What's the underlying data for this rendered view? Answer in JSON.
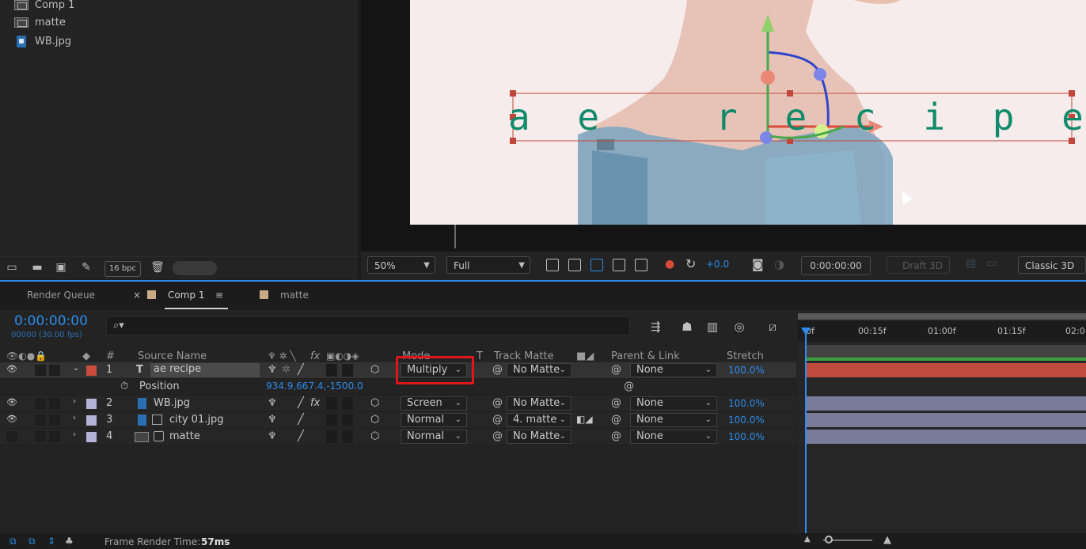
{
  "project": {
    "items": [
      {
        "name": "Comp 1",
        "icon": "comp-icon"
      },
      {
        "name": "matte",
        "icon": "comp-icon"
      },
      {
        "name": "WB.jpg",
        "icon": "image-file-icon"
      }
    ],
    "bpc": "16 bpc"
  },
  "viewer": {
    "overlay_text": "a e   r e c i p e",
    "zoom": "50%",
    "resolution": "Full",
    "exposure_offset": "+0.0",
    "timecode": "0:00:00:00",
    "draft3d": "Draft 3D",
    "renderer": "Classic 3D"
  },
  "timeline": {
    "tabs": [
      {
        "label": "Render Queue"
      },
      {
        "label": "Comp 1",
        "active": true
      },
      {
        "label": "matte"
      }
    ],
    "current_time": "0:00:00:00",
    "fps": "00000 (30.00 fps)",
    "search_placeholder": "⌕▾",
    "columns": {
      "number": "#",
      "source_name": "Source Name",
      "mode": "Mode",
      "t": "T",
      "track_matte": "Track Matte",
      "parent_link": "Parent & Link",
      "stretch": "Stretch"
    },
    "layers": [
      {
        "num": "1",
        "name": "ae recipe",
        "type": "text",
        "mode": "Multiply",
        "matte": "No Matte",
        "parent": "None",
        "stretch": "100.0%",
        "label_color": "#c84b3c"
      },
      {
        "num": "2",
        "name": "WB.jpg",
        "type": "image",
        "mode": "Screen",
        "matte": "No Matte",
        "parent": "None",
        "stretch": "100.0%",
        "label_color": "#b4b4d8"
      },
      {
        "num": "3",
        "name": "city 01.jpg",
        "type": "image",
        "mode": "Normal",
        "matte": "4. matte",
        "parent": "None",
        "stretch": "100.0%",
        "label_color": "#b4b4d8"
      },
      {
        "num": "4",
        "name": "matte",
        "type": "comp",
        "mode": "Normal",
        "matte": "No Matte",
        "parent": "None",
        "stretch": "100.0%",
        "label_color": "#b4b4d8"
      }
    ],
    "position": {
      "label": "Position",
      "value": "934.9,667.4,-1500.0"
    },
    "ruler": [
      "0f",
      "00:15f",
      "01:00f",
      "01:15f",
      "02:0"
    ],
    "fx_label": "fx"
  },
  "status": {
    "frame_render_label": "Frame Render Time:",
    "frame_render_value": "57ms"
  },
  "colors": {
    "accent": "#2d8ceb",
    "highlight": "#e0161a",
    "text_color_overlay": "#0f8a6a",
    "layer1_bar": "#c04a3c",
    "layer_bar": "#7a7a9a"
  }
}
